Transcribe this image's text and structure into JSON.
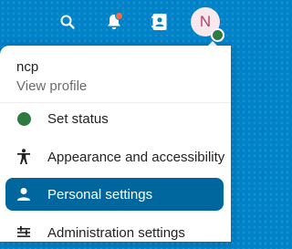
{
  "header": {
    "icons": [
      "search-icon",
      "notifications-icon",
      "contacts-icon"
    ],
    "avatar_initial": "N",
    "notification_dot_color": "#ff6a3d",
    "online_status_color": "#2d7b41",
    "background_color": "#0082c9"
  },
  "profile": {
    "name": "ncp",
    "view_profile_label": "View profile"
  },
  "menu": {
    "items": [
      {
        "label": "Set status",
        "icon": "status-dot-icon",
        "active": false
      },
      {
        "label": "Appearance and accessibility",
        "icon": "accessibility-icon",
        "active": false
      },
      {
        "label": "Personal settings",
        "icon": "person-icon",
        "active": true
      },
      {
        "label": "Administration settings",
        "icon": "admin-settings-icon",
        "active": false
      }
    ],
    "active_color": "#00679e"
  }
}
